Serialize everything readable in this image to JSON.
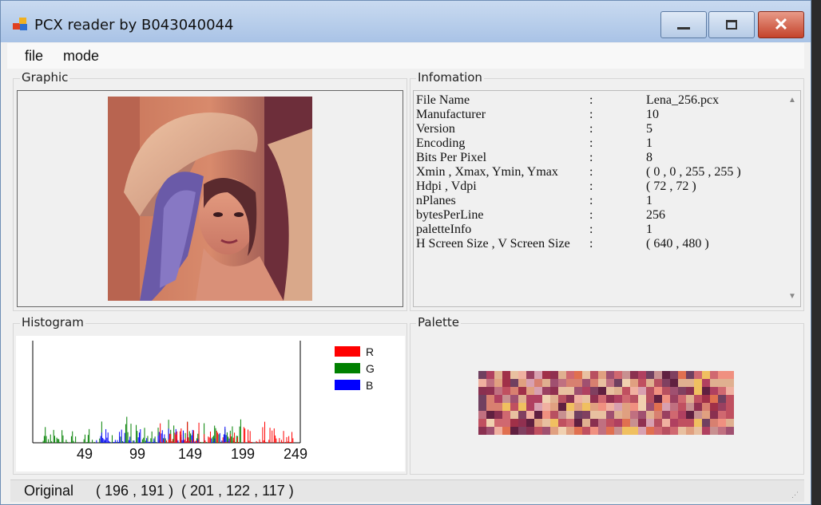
{
  "window": {
    "title": "PCX reader by B043040044",
    "buttons": {
      "minimize": "minimize",
      "maximize": "maximize",
      "close": "close"
    }
  },
  "menu": {
    "items": [
      "file",
      "mode"
    ]
  },
  "groups": {
    "graphic": "Graphic",
    "information": "Infomation",
    "histogram": "Histogram",
    "palette": "Palette"
  },
  "info": {
    "rows": [
      {
        "key": "File Name",
        "value": "Lena_256.pcx"
      },
      {
        "key": "Manufacturer",
        "value": "10"
      },
      {
        "key": "Version",
        "value": "5"
      },
      {
        "key": "Encoding",
        "value": "1"
      },
      {
        "key": "Bits Per Pixel",
        "value": "8"
      },
      {
        "key": "Xmin , Xmax, Ymin, Ymax",
        "value": "( 0 , 0 , 255 , 255 )"
      },
      {
        "key": "Hdpi , Vdpi",
        "value": "( 72 , 72 )"
      },
      {
        "key": "nPlanes",
        "value": "1"
      },
      {
        "key": "bytesPerLine",
        "value": "256"
      },
      {
        "key": "paletteInfo",
        "value": "1"
      },
      {
        "key": "H Screen Size , V Screen Size",
        "value": "( 640 , 480 )"
      }
    ],
    "colon": ":"
  },
  "histogram": {
    "legend": [
      {
        "name": "R",
        "color": "#ff0000"
      },
      {
        "name": "G",
        "color": "#008000"
      },
      {
        "name": "B",
        "color": "#0000ff"
      }
    ],
    "x_ticks": [
      "49",
      "99",
      "149",
      "199",
      "249"
    ]
  },
  "chart_data": {
    "type": "bar",
    "x_ticks": [
      49,
      99,
      149,
      199,
      249
    ],
    "series": [
      {
        "name": "R",
        "color": "#ff0000"
      },
      {
        "name": "G",
        "color": "#008000"
      },
      {
        "name": "B",
        "color": "#0000ff"
      }
    ]
  },
  "status": {
    "mode": "Original",
    "coordinates": "( 196 , 191 )",
    "rgb": "( 201 , 122 , 117 )"
  }
}
